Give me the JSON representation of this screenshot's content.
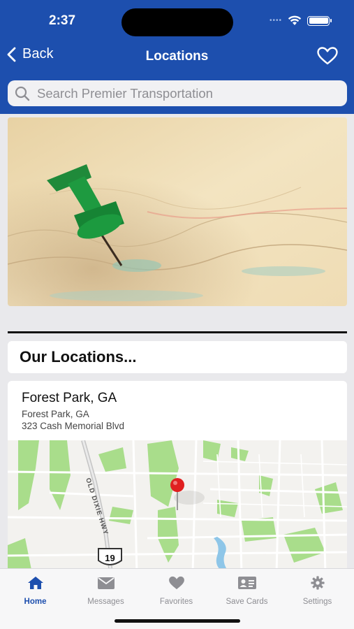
{
  "status": {
    "time": "2:37"
  },
  "nav": {
    "back_label": "Back",
    "title": "Locations"
  },
  "search": {
    "placeholder": "Search Premier Transportation"
  },
  "section": {
    "title": "Our Locations..."
  },
  "location": {
    "name": "Forest Park, GA",
    "city": "Forest Park, GA",
    "street": "323 Cash Memorial Blvd"
  },
  "map": {
    "road_label": "OLD DIXIE HWY",
    "route_number": "19"
  },
  "tabs": [
    {
      "label": "Home",
      "icon": "home-icon",
      "active": true
    },
    {
      "label": "Messages",
      "icon": "envelope-icon",
      "active": false
    },
    {
      "label": "Favorites",
      "icon": "heart-icon",
      "active": false
    },
    {
      "label": "Save Cards",
      "icon": "id-card-icon",
      "active": false
    },
    {
      "label": "Settings",
      "icon": "gear-icon",
      "active": false
    }
  ],
  "colors": {
    "header": "#1d4fae",
    "active_tab": "#1d4fae",
    "inactive_tab": "#8e8e93",
    "map_pin": "#e02020"
  }
}
